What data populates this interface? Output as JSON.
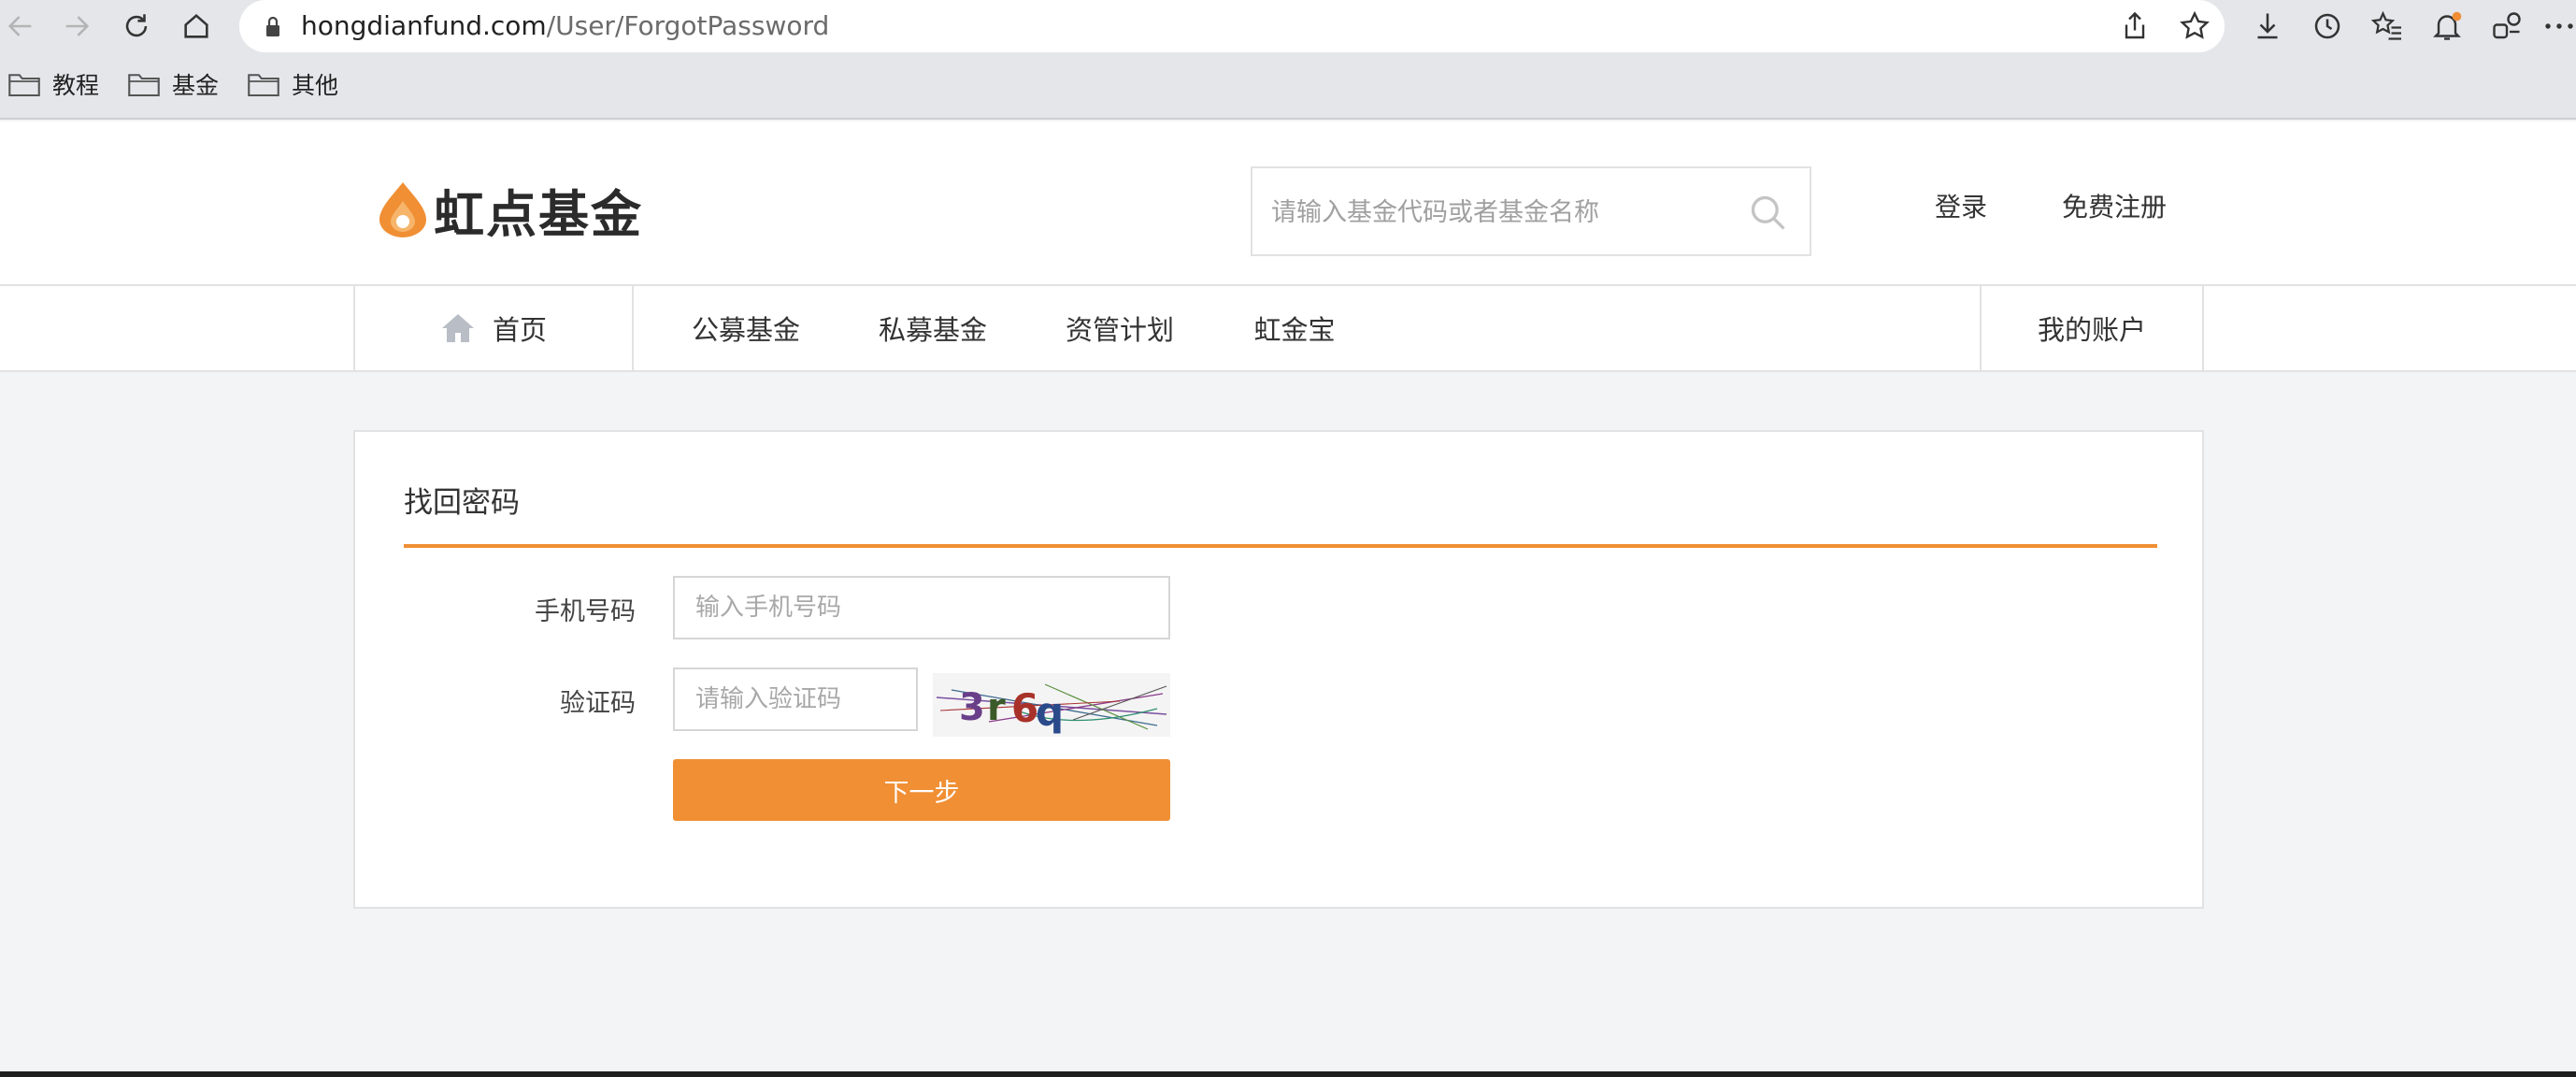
{
  "browser": {
    "url_host": "hongdianfund.com",
    "url_path": "/User/ForgotPassword",
    "bookmarks": [
      {
        "label": "教程"
      },
      {
        "label": "基金"
      },
      {
        "label": "其他"
      }
    ]
  },
  "site": {
    "logo_text": "虹点基金",
    "search": {
      "placeholder": "请输入基金代码或者基金名称"
    },
    "top_links": {
      "login": "登录",
      "register": "免费注册"
    },
    "nav": {
      "home": "首页",
      "items": [
        "公募基金",
        "私募基金",
        "资管计划",
        "虹金宝"
      ],
      "account": "我的账户"
    },
    "colors": {
      "accent": "#f08f34",
      "home_icon": "#b9bdc6"
    }
  },
  "form": {
    "title": "找回密码",
    "phone_label": "手机号码",
    "phone_placeholder": "输入手机号码",
    "captcha_label": "验证码",
    "captcha_placeholder": "请输入验证码",
    "captcha_image_text": "3r6q",
    "submit_label": "下一步"
  }
}
